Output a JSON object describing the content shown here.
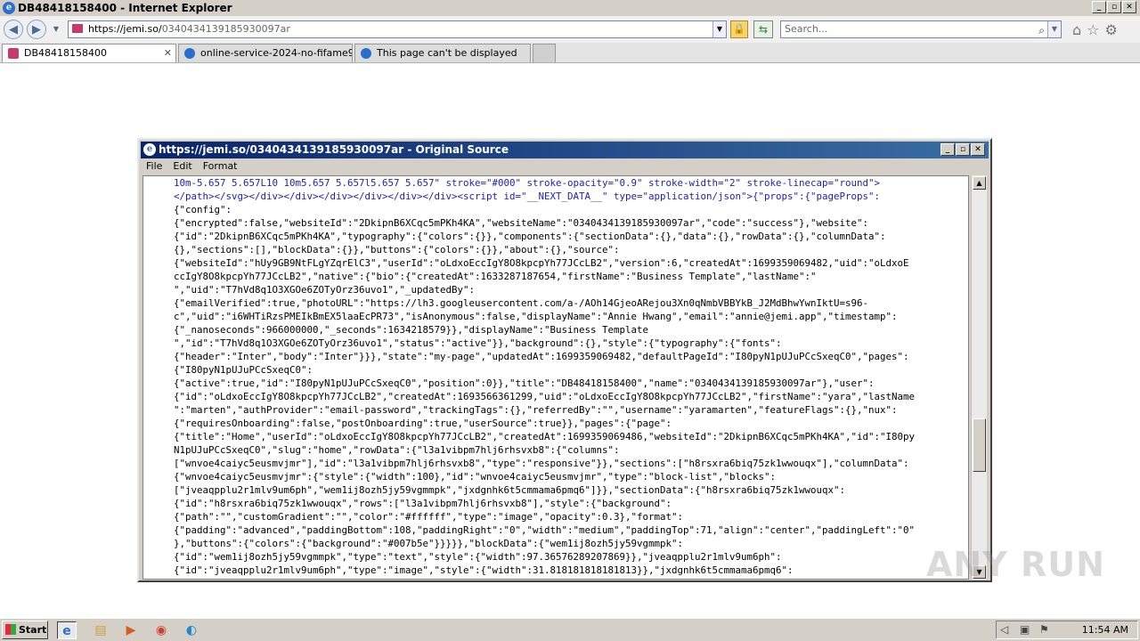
{
  "window": {
    "title": "DB48418158400 - Internet Explorer",
    "minimize": "_",
    "maximize": "▫",
    "close": "✕"
  },
  "address": {
    "url_host": "https://jemi.so/",
    "url_path": "0340434139185930097ar",
    "search_placeholder": "Search..."
  },
  "tabs": [
    {
      "label": "DB48418158400",
      "close": "✕"
    },
    {
      "label": "online-service-2024-no-fifame9..."
    },
    {
      "label": "This page can't be displayed"
    }
  ],
  "source_window": {
    "title": "https://jemi.so/0340434139185930097ar - Original Source",
    "menu": [
      "File",
      "Edit",
      "Format"
    ],
    "lines": [
      "10m-5.657 5.657L10 10m5.657 5.657l5.657 5.657\" stroke=\"#000\" stroke-opacity=\"0.9\" stroke-width=\"2\" stroke-linecap=\"round\">",
      "</path></svg></div></div></div></div></div></div><script id=\"__NEXT_DATA__\" type=\"application/json\">{\"props\":{\"pageProps\":",
      "{\"config\":",
      "{\"encrypted\":false,\"websiteId\":\"2DkipnB6XCqc5mPKh4KA\",\"websiteName\":\"0340434139185930097ar\",\"code\":\"success\"},\"website\":",
      "{\"id\":\"2DkipnB6XCqc5mPKh4KA\",\"typography\":{\"colors\":{}},\"components\":{\"sectionData\":{},\"data\":{},\"rowData\":{},\"columnData\":",
      "{},\"sections\":[],\"blockData\":{}},\"buttons\":{\"colors\":{}},\"about\":{},\"source\":",
      "{\"websiteId\":\"hUy9GB9NtFLgYZqrElC3\",\"userId\":\"oLdxoEccIgY8O8kpcpYh77JCcLB2\",\"version\":6,\"createdAt\":1699359069482,\"uid\":\"oLdxoE",
      "ccIgY8O8kpcpYh77JCcLB2\",\"native\":{\"bio\":{\"createdAt\":1633287187654,\"firstName\":\"Business Template\",\"lastName\":\"",
      "\",\"uid\":\"T7hVd8q1O3XGOe6ZOTyOrz36uvo1\",\"_updatedBy\":",
      "{\"emailVerified\":true,\"photoURL\":\"https://lh3.googleusercontent.com/a-/AOh14GjeoARejou3Xn0qNmbVBBYkB_J2MdBhwYwnIktU=s96-",
      "c\",\"uid\":\"i6WHTiRzsPMEIkBmEX5laaEcPR73\",\"isAnonymous\":false,\"displayName\":\"Annie Hwang\",\"email\":\"annie@jemi.app\",\"timestamp\":",
      "{\"_nanoseconds\":966000000,\"_seconds\":1634218579}},\"displayName\":\"Business Template",
      "\",\"id\":\"T7hVd8q1O3XGOe6ZOTyOrz36uvo1\",\"status\":\"active\"}},\"background\":{},\"style\":{\"typography\":{\"fonts\":",
      "{\"header\":\"Inter\",\"body\":\"Inter\"}}},\"state\":\"my-page\",\"updatedAt\":1699359069482,\"defaultPageId\":\"I80pyN1pUJuPCcSxeqC0\",\"pages\":",
      "{\"I80pyN1pUJuPCcSxeqC0\":",
      "{\"active\":true,\"id\":\"I80pyN1pUJuPCcSxeqC0\",\"position\":0}},\"title\":\"DB48418158400\",\"name\":\"0340434139185930097ar\"},\"user\":",
      "{\"id\":\"oLdxoEccIgY8O8kpcpYh77JCcLB2\",\"createdAt\":1693566361299,\"uid\":\"oLdxoEccIgY8O8kpcpYh77JCcLB2\",\"firstName\":\"yara\",\"lastName",
      "\":\"marten\",\"authProvider\":\"email-password\",\"trackingTags\":{},\"referredBy\":\"\",\"username\":\"yaramarten\",\"featureFlags\":{},\"nux\":",
      "{\"requiresOnboarding\":false,\"postOnboarding\":true,\"userSource\":true}},\"pages\":{\"page\":",
      "{\"title\":\"Home\",\"userId\":\"oLdxoEccIgY8O8kpcpYh77JCcLB2\",\"createdAt\":1699359069486,\"websiteId\":\"2DkipnB6XCqc5mPKh4KA\",\"id\":\"I80py",
      "N1pUJuPCcSxeqC0\",\"slug\":\"home\",\"rowData\":{\"l3a1vibpm7hlj6rhsvxb8\":{\"columns\":",
      "[\"wnvoe4caiyc5eusmvjmr\"],\"id\":\"l3a1vibpm7hlj6rhsvxb8\",\"type\":\"responsive\"}},\"sections\":[\"h8rsxra6biq75zk1wwouqx\"],\"columnData\":",
      "{\"wnvoe4caiyc5eusmvjmr\":{\"style\":{\"width\":100},\"id\":\"wnvoe4caiyc5eusmvjmr\",\"type\":\"block-list\",\"blocks\":",
      "[\"jveaqpplu2r1mlv9um6ph\",\"wem1ij8ozh5jy59vgmmpk\",\"jxdgnhk6t5cmmama6pmq6\"]}},\"sectionData\":{\"h8rsxra6biq75zk1wwouqx\":",
      "{\"id\":\"h8rsxra6biq75zk1wwouqx\",\"rows\":[\"l3a1vibpm7hlj6rhsvxb8\"],\"style\":{\"background\":",
      "{\"path\":\"\",\"customGradient\":\"\",\"color\":\"#ffffff\",\"type\":\"image\",\"opacity\":0.3},\"format\":",
      "{\"padding\":\"advanced\",\"paddingBottom\":108,\"paddingRight\":\"0\",\"width\":\"medium\",\"paddingTop\":71,\"align\":\"center\",\"paddingLeft\":\"0\"",
      "},\"buttons\":{\"colors\":{\"background\":\"#007b5e\"}}}}},\"blockData\":{\"wem1ij8ozh5jy59vgmmpk\":",
      "{\"id\":\"wem1ij8ozh5jy59vgmmpk\",\"type\":\"text\",\"style\":{\"width\":97.36576289207869}},\"jveaqpplu2r1mlv9um6ph\":",
      "{\"id\":\"jveaqpplu2r1mlv9um6ph\",\"type\":\"image\",\"style\":{\"width\":31.818181818181813}},\"jxdgnhk6t5cmmama6pmq6\":"
    ]
  },
  "watermark": "ANY RUN",
  "taskbar": {
    "start_label": "Start",
    "clock": "11:54 AM"
  },
  "colors": {
    "title_bar_active": "#0a246a",
    "accent": "#3a6ea5"
  }
}
